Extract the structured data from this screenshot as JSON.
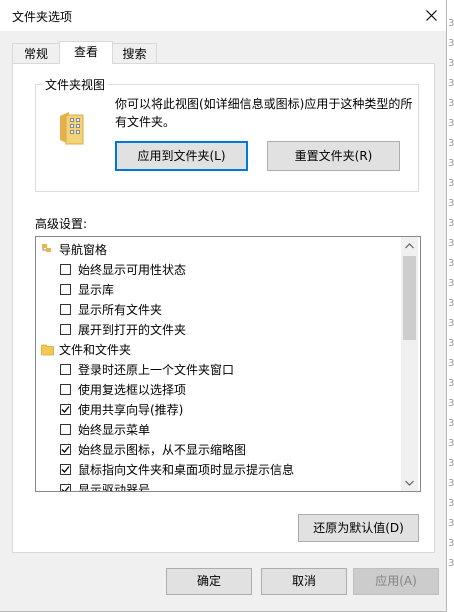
{
  "window": {
    "title": "文件夹选项"
  },
  "tabs": [
    {
      "label": "常规",
      "active": false
    },
    {
      "label": "查看",
      "active": true
    },
    {
      "label": "搜索",
      "active": false
    }
  ],
  "folder_views": {
    "group_title": "文件夹视图",
    "description": "你可以将此视图(如详细信息或图标)应用于这种类型的所有文件夹。",
    "apply_label": "应用到文件夹(L)",
    "reset_label": "重置文件夹(R)"
  },
  "advanced": {
    "label": "高级设置:",
    "items": [
      {
        "type": "folder",
        "text": "导航窗格",
        "icon": "navigation-pane-icon"
      },
      {
        "type": "checkbox",
        "text": "始终显示可用性状态",
        "checked": false
      },
      {
        "type": "checkbox",
        "text": "显示库",
        "checked": false
      },
      {
        "type": "checkbox",
        "text": "显示所有文件夹",
        "checked": false
      },
      {
        "type": "checkbox",
        "text": "展开到打开的文件夹",
        "checked": false
      },
      {
        "type": "folder",
        "text": "文件和文件夹",
        "icon": "folder-icon"
      },
      {
        "type": "checkbox",
        "text": "登录时还原上一个文件夹窗口",
        "checked": false
      },
      {
        "type": "checkbox",
        "text": "使用复选框以选择项",
        "checked": false
      },
      {
        "type": "checkbox",
        "text": "使用共享向导(推荐)",
        "checked": true
      },
      {
        "type": "checkbox",
        "text": "始终显示菜单",
        "checked": false
      },
      {
        "type": "checkbox",
        "text": "始终显示图标，从不显示缩略图",
        "checked": true
      },
      {
        "type": "checkbox",
        "text": "鼠标指向文件夹和桌面项时显示提示信息",
        "checked": true
      },
      {
        "type": "checkbox",
        "text": "显示驱动器号",
        "checked": true
      }
    ],
    "restore_label": "还原为默认值(D)"
  },
  "footer": {
    "ok_label": "确定",
    "cancel_label": "取消",
    "apply_label": "应用(A)"
  },
  "background_strip": [
    "3",
    "3",
    "3",
    "3",
    "3",
    "3",
    "3",
    "3",
    "3",
    "3",
    "3",
    "3",
    "3",
    "3",
    "3",
    "3",
    "3",
    "3",
    "3",
    "3",
    "3",
    "3",
    "3",
    "3",
    "3",
    "3",
    "3",
    "3"
  ],
  "colors": {
    "accent": "#0078d7",
    "check_mark": "#000000"
  }
}
